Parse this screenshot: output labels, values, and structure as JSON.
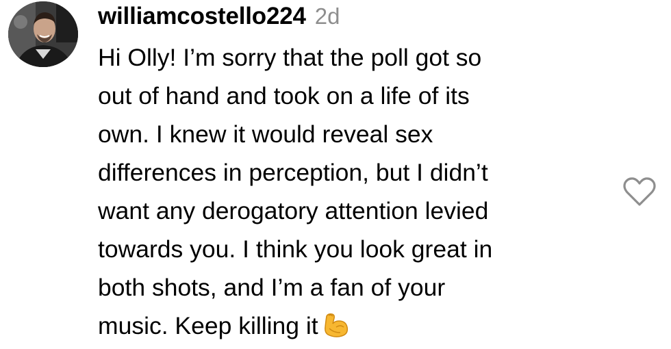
{
  "comment": {
    "username": "williamcostello224",
    "timestamp": "2d",
    "text_lines": [
      "Hi Olly! I’m sorry that the poll got so",
      "out of hand and took on a life of its",
      "own. I knew it would reveal sex",
      "differences in perception, but I didn’t",
      "want any derogatory attention levied",
      "towards you. I think you look great in",
      "both shots, and I’m a fan of your",
      "music. Keep killing it"
    ],
    "emoji": "flexed-biceps",
    "like_icon": "heart-outline-icon",
    "colors": {
      "username": "#000000",
      "timestamp": "#8e8e8e",
      "like_icon": "#8e8e8e",
      "emoji": "#f7b731"
    }
  }
}
